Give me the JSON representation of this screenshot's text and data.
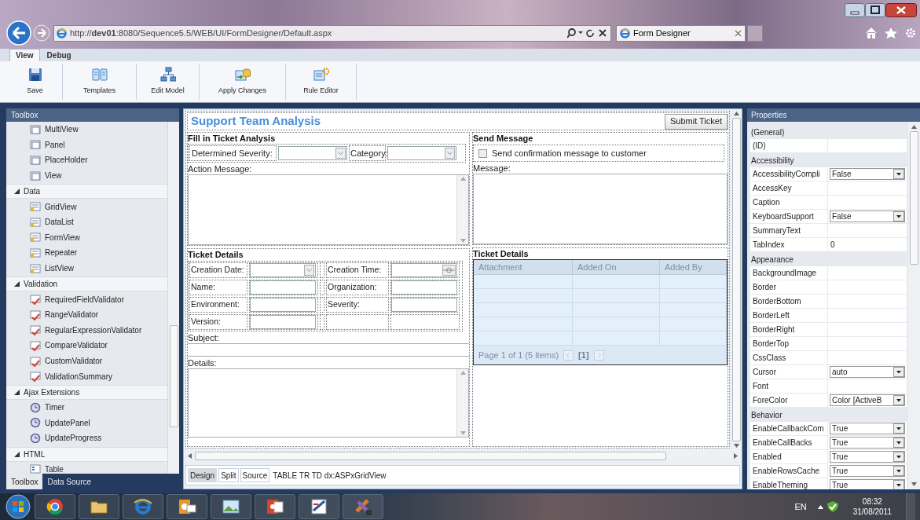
{
  "browser": {
    "address": "http://**dev01**:8080/Sequence5.5/WEB/UI/FormDesigner/Default.aspx",
    "tab_title": "Form Designer"
  },
  "ribbon": {
    "tabs": [
      {
        "label": "View",
        "selected": true
      },
      {
        "label": "Debug",
        "selected": false
      }
    ],
    "buttons": [
      {
        "label": "Save",
        "kind": "save"
      },
      {
        "label": "Templates",
        "kind": "templates"
      },
      {
        "label": "Edit Model",
        "kind": "model"
      },
      {
        "label": "Apply Changes",
        "kind": "apply"
      },
      {
        "label": "Rule Editor",
        "kind": "rules"
      }
    ]
  },
  "toolbox": {
    "title": "Toolbox",
    "sections": [
      {
        "items": [
          "MultiView",
          "Panel",
          "PlaceHolder",
          "View"
        ]
      },
      {
        "header": "Data",
        "expanded": true,
        "items": [
          "GridView",
          "DataList",
          "FormView",
          "Repeater",
          "ListView"
        ]
      },
      {
        "header": "Validation",
        "expanded": true,
        "items": [
          "RequiredFieldValidator",
          "RangeValidator",
          "RegularExpressionValidator",
          "CompareValidator",
          "CustomValidator",
          "ValidationSummary"
        ]
      },
      {
        "header": "Ajax Extensions",
        "expanded": true,
        "items": [
          "Timer",
          "UpdatePanel",
          "UpdateProgress"
        ]
      },
      {
        "header": "HTML",
        "expanded": true,
        "items": [
          "Table"
        ]
      }
    ],
    "tabs": [
      {
        "label": "Toolbox",
        "selected": true
      },
      {
        "label": "Data Source",
        "selected": false
      }
    ]
  },
  "designer": {
    "title": "Support Team Analysis",
    "submit_button": "Submit Ticket",
    "analysis": {
      "heading": "Fill in Ticket Analysis",
      "severity_label": "Determined Severity:",
      "category_label": "Category:",
      "message_label": "Action Message:"
    },
    "send_message": {
      "heading": "Send Message",
      "checkbox": {
        "label": "Send confirmation message to customer",
        "checked": false
      },
      "message_label": "Message:"
    },
    "ticket_details": {
      "heading": "Ticket Details",
      "fields": [
        {
          "label": "Creation Date:",
          "kind": "date"
        },
        {
          "label": "Creation Time:",
          "kind": "time"
        },
        {
          "label": "Name:",
          "kind": "text"
        },
        {
          "label": "Organization:",
          "kind": "text"
        },
        {
          "label": "Environment:",
          "kind": "text"
        },
        {
          "label": "Severity:",
          "kind": "text"
        },
        {
          "label": "Version:",
          "kind": "text"
        }
      ],
      "subject_label": "Subject:",
      "details_label": "Details:"
    },
    "attachments": {
      "heading": "Ticket Details",
      "columns": [
        "Attachment",
        "Added On",
        "Added By"
      ],
      "pager": "Page 1 of 1 (5 items)",
      "current_page": "[1]"
    },
    "view_tabs": [
      {
        "label": "Design",
        "selected": true
      },
      {
        "label": "Split",
        "selected": false
      },
      {
        "label": "Source",
        "selected": false
      }
    ],
    "path": "TABLE TR TD dx:ASPxGridView"
  },
  "properties": {
    "title": "Properties",
    "groups": [
      {
        "name": "(General)",
        "rows": [
          {
            "name": "(ID)",
            "kind": "text"
          }
        ]
      },
      {
        "name": "Accessibility",
        "rows": [
          {
            "name": "AccessibilityCompli",
            "kind": "dropdown",
            "value": "False"
          },
          {
            "name": "AccessKey",
            "kind": "text"
          },
          {
            "name": "Caption",
            "kind": "text"
          },
          {
            "name": "KeyboardSupport",
            "kind": "dropdown",
            "value": "False"
          },
          {
            "name": "SummaryText",
            "kind": "text"
          },
          {
            "name": "TabIndex",
            "kind": "text",
            "value": "0"
          }
        ]
      },
      {
        "name": "Appearance",
        "rows": [
          {
            "name": "BackgroundImage",
            "kind": "text"
          },
          {
            "name": "Border",
            "kind": "text"
          },
          {
            "name": "BorderBottom",
            "kind": "text"
          },
          {
            "name": "BorderLeft",
            "kind": "text"
          },
          {
            "name": "BorderRight",
            "kind": "text"
          },
          {
            "name": "BorderTop",
            "kind": "text"
          },
          {
            "name": "CssClass",
            "kind": "text"
          },
          {
            "name": "Cursor",
            "kind": "dropdown",
            "value": "auto"
          },
          {
            "name": "Font",
            "kind": "text"
          },
          {
            "name": "ForeColor",
            "kind": "dropdown",
            "value": "Color [ActiveB"
          }
        ]
      },
      {
        "name": "Behavior",
        "rows": [
          {
            "name": "EnableCallbackCom",
            "kind": "dropdown",
            "value": "True"
          },
          {
            "name": "EnableCallBacks",
            "kind": "dropdown",
            "value": "True"
          },
          {
            "name": "Enabled",
            "kind": "dropdown",
            "value": "True"
          },
          {
            "name": "EnableRowsCache",
            "kind": "dropdown",
            "value": "True"
          },
          {
            "name": "EnableTheming",
            "kind": "dropdown",
            "value": "True"
          }
        ]
      }
    ]
  },
  "taskbar": {
    "language": "EN",
    "time": "08:32",
    "date": "31/08/2011"
  }
}
